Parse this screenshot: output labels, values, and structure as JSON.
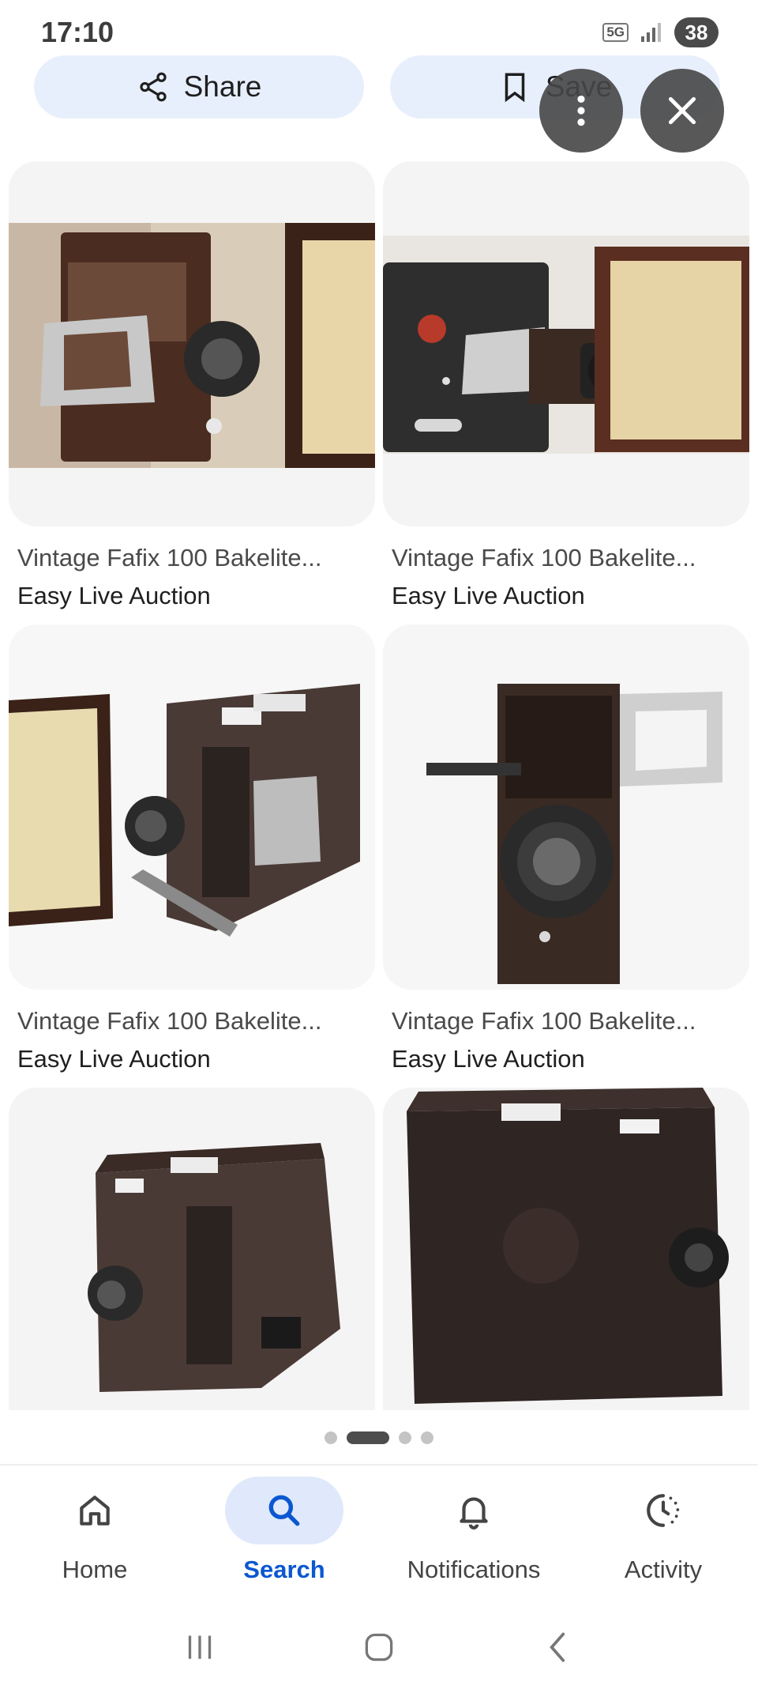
{
  "status_bar": {
    "time": "17:10",
    "network": "5G",
    "battery": "38"
  },
  "actions": {
    "share_label": "Share",
    "save_label": "Save"
  },
  "results": [
    {
      "title": "Vintage Fafix 100 Bakelite...",
      "source": "Easy Live Auction"
    },
    {
      "title": "Vintage Fafix 100 Bakelite...",
      "source": "Easy Live Auction"
    },
    {
      "title": "Vintage Fafix 100 Bakelite...",
      "source": "Easy Live Auction"
    },
    {
      "title": "Vintage Fafix 100 Bakelite...",
      "source": "Easy Live Auction"
    },
    {
      "title": "",
      "source": ""
    },
    {
      "title": "",
      "source": ""
    }
  ],
  "pagination": {
    "pages": 4,
    "active_index": 1
  },
  "bottom_nav": {
    "items": [
      {
        "label": "Home",
        "icon": "home-icon"
      },
      {
        "label": "Search",
        "icon": "search-icon",
        "active": true
      },
      {
        "label": "Notifications",
        "icon": "bell-icon"
      },
      {
        "label": "Activity",
        "icon": "activity-icon"
      }
    ]
  },
  "colors": {
    "accent": "#0b57d0",
    "pill_bg": "#e8effc",
    "nav_active_bg": "#dfe9fb"
  }
}
